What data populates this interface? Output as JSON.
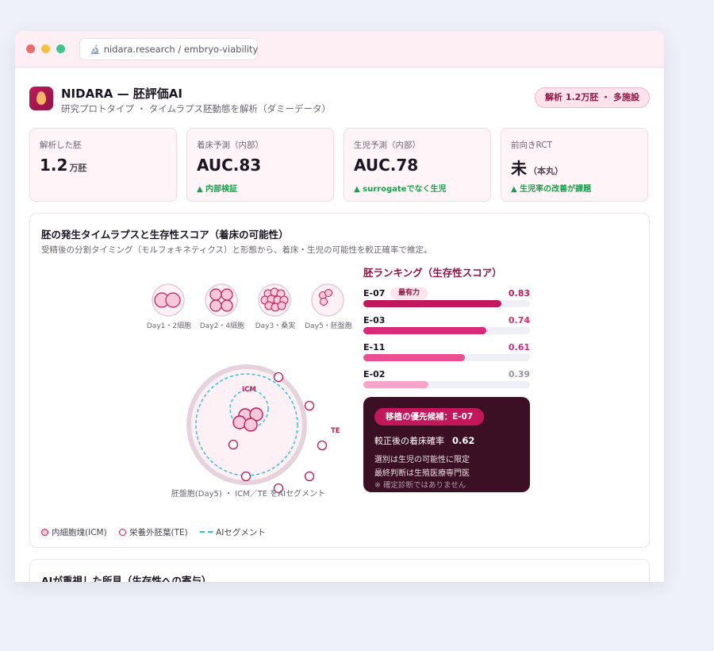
{
  "window": {
    "url": "nidara.research / embryo-viability",
    "url_icon": "microscope-icon"
  },
  "header": {
    "title": "NIDARA — 胚評価AI",
    "subtitle": "研究プロトタイプ ・ タイムラプス胚動態を解析（ダミーデータ）",
    "badge": "解析 1.2万胚 ・ 多施設"
  },
  "stats": [
    {
      "label": "解析した胚",
      "value": "1.2",
      "unit": "万胚",
      "note": ""
    },
    {
      "label": "着床予測（内部）",
      "value": "AUC.83",
      "unit": "",
      "note": "▲ 内部検証"
    },
    {
      "label": "生児予測（内部）",
      "value": "AUC.78",
      "unit": "",
      "note": "▲ surrogateでなく生児"
    },
    {
      "label": "前向きRCT",
      "value": "未",
      "unit": "（本丸）",
      "note": "▲ 生児率の改善が課題"
    }
  ],
  "panel": {
    "title": "胚の発生タイムラプスと生存性スコア（着床の可能性）",
    "subtitle": "受精後の分割タイミング（モルフォキネティクス）と形態から、着床・生児の可能性を較正確率で推定。",
    "stages": [
      "Day1・2細胞",
      "Day2・4細胞",
      "Day3・桑実",
      "Day5・胚盤胞"
    ],
    "icm_label": "ICM",
    "te_label": "TE",
    "blast_caption": "胚盤胞(Day5) ・ ICM／TE をAIセグメント"
  },
  "ranking": {
    "title": "胚ランキング（生存性スコア）",
    "items": [
      {
        "id": "E-07",
        "tag": "最有力",
        "score": 0.83,
        "score_label": "0.83",
        "color": "#c2185b",
        "score_color": "#c2185b"
      },
      {
        "id": "E-03",
        "tag": "",
        "score": 0.74,
        "score_label": "0.74",
        "color": "#d92a77",
        "score_color": "#d92a77"
      },
      {
        "id": "E-11",
        "tag": "",
        "score": 0.61,
        "score_label": "0.61",
        "color": "#ea4f92",
        "score_color": "#d92a77"
      },
      {
        "id": "E-02",
        "tag": "",
        "score": 0.39,
        "score_label": "0.39",
        "color": "#f7a5c6",
        "score_color": "#9a94a0"
      }
    ]
  },
  "candidate": {
    "badge": "移植の優先候補：E-07",
    "prob_label": "較正後の着床確率",
    "prob_value": "0.62",
    "line1": "選別は生児の可能性に限定",
    "line2": "最終判断は生殖医療専門医",
    "line3": "※ 確定診断ではありません"
  },
  "legend": {
    "icm": "内細胞塊(ICM)",
    "te": "栄養外胚葉(TE)",
    "seg": "AIセグメント"
  },
  "panel2": {
    "title": "AIが重視した所見（生存性への寄与）"
  }
}
